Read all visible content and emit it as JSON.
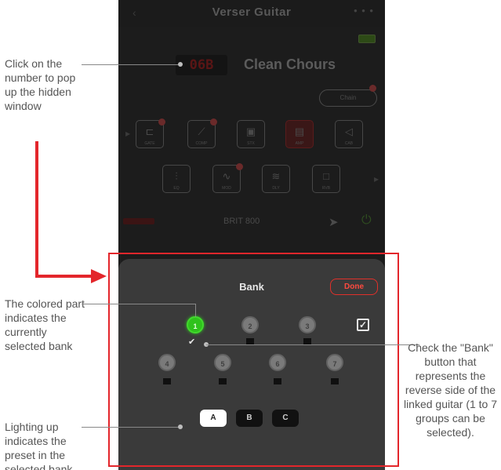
{
  "app": {
    "title": "Verser Guitar"
  },
  "preset": {
    "number": "06B",
    "name": "Clean Chours",
    "chain_label": "Chain"
  },
  "modules": [
    {
      "label": "GATE"
    },
    {
      "label": "COMP"
    },
    {
      "label": "STX"
    },
    {
      "label": "AMP"
    },
    {
      "label": "CAB"
    },
    {
      "label": "EQ"
    },
    {
      "label": "MOD"
    },
    {
      "label": "DLY"
    },
    {
      "label": "RVB"
    }
  ],
  "amp_model": "BRIT 800",
  "bank_popup": {
    "title": "Bank",
    "done_label": "Done",
    "banks": [
      "1",
      "2",
      "3",
      "4",
      "5",
      "6",
      "7"
    ],
    "selected_bank": "1",
    "bank_checkbox_checked": true,
    "presets": [
      "A",
      "B",
      "C"
    ],
    "selected_preset": "A"
  },
  "annotations": {
    "click_number": "Click on the number to pop up the hidden window",
    "colored_part": "The colored part indicates the currently selected bank",
    "lighting_up": "Lighting up indicates the preset in the selected bank",
    "check_bank": "Check the \"Bank\" button that represents the reverse side of the linked guitar (1 to 7 groups can be selected)."
  },
  "colors": {
    "highlight_red": "#e3262b",
    "selected_green": "#2fc21c",
    "done_red": "#ff4a3f"
  }
}
